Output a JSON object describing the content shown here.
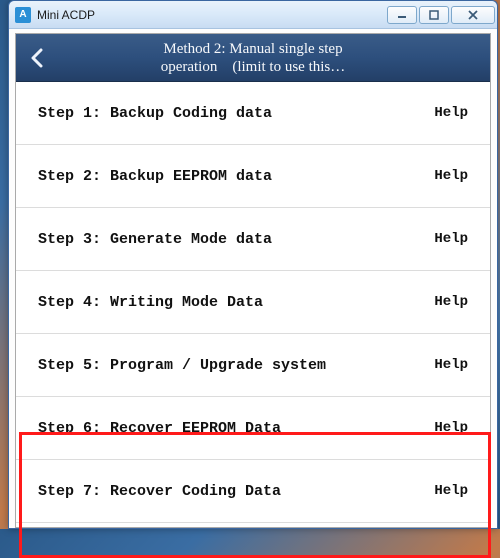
{
  "window": {
    "title": "Mini ACDP"
  },
  "header": {
    "line1": "Method 2: Manual single step",
    "line2": "operation (limit to use this…"
  },
  "help_label": "Help",
  "steps": [
    {
      "label": "Step 1: Backup Coding data"
    },
    {
      "label": "Step 2: Backup EEPROM data"
    },
    {
      "label": "Step 3: Generate Mode data"
    },
    {
      "label": "Step 4: Writing Mode Data"
    },
    {
      "label": "Step 5: Program / Upgrade system"
    },
    {
      "label": "Step 6: Recover EEPROM Data"
    },
    {
      "label": "Step 7: Recover Coding Data"
    }
  ]
}
